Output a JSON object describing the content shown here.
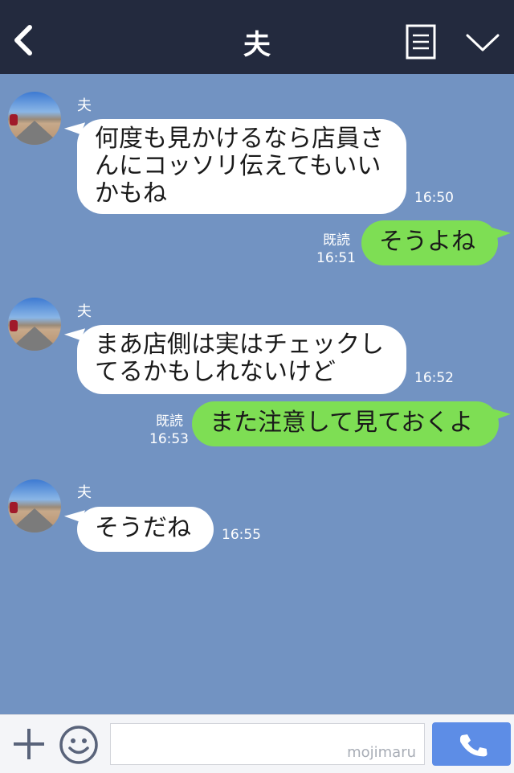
{
  "header": {
    "title": "夫",
    "back_icon": "chevron-left-icon",
    "menu_icon": "list-icon",
    "collapse_icon": "chevron-down-icon"
  },
  "messages": [
    {
      "sender": "夫",
      "text": "何度も見かけるなら店員さ\nんにコッソリ伝えてもいい\nかもね",
      "time": "16:50"
    },
    {
      "text": "そうよね",
      "read": "既読",
      "time": "16:51"
    },
    {
      "sender": "夫",
      "text": "まあ店側は実はチェックし\nてるかもしれないけど",
      "time": "16:52"
    },
    {
      "text": "また注意して見ておくよ",
      "read": "既読",
      "time": "16:53"
    },
    {
      "sender": "夫",
      "text": "そうだね",
      "time": "16:55"
    }
  ],
  "footer": {
    "watermark": "mojimaru",
    "plus_icon": "plus-icon",
    "emoji_icon": "smiley-icon",
    "call_icon": "phone-icon"
  },
  "colors": {
    "header_bg": "#232a3e",
    "chat_bg": "#7293c2",
    "outgoing_bubble": "#7ede54",
    "incoming_bubble": "#ffffff",
    "call_button": "#5d8de6"
  }
}
